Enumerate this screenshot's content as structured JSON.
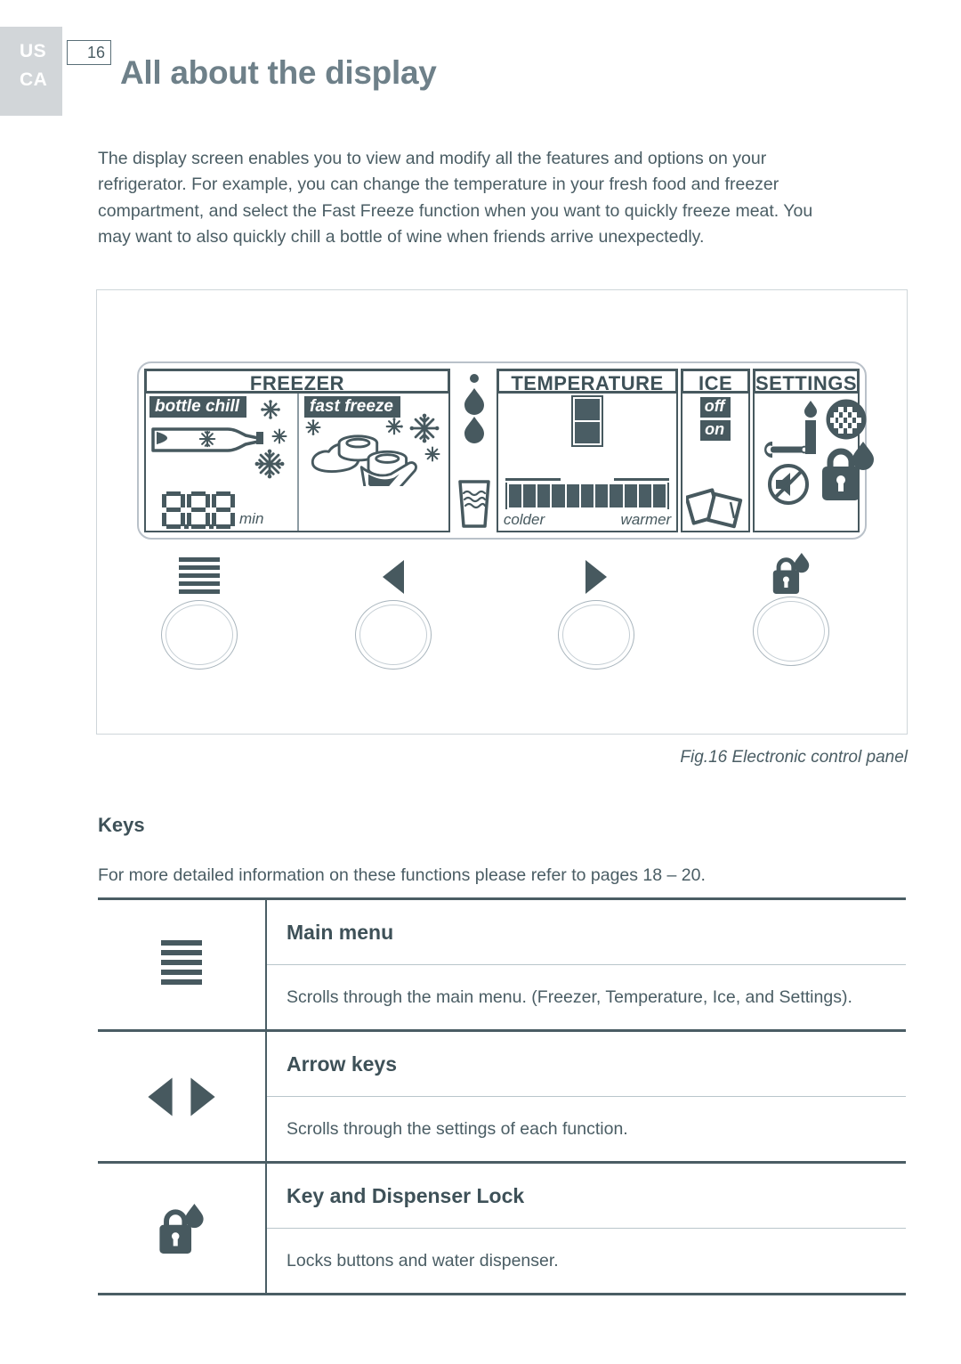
{
  "header": {
    "region_line1": "US",
    "region_line2": "CA",
    "page_number": "16",
    "title": "All about the display"
  },
  "intro": {
    "paragraph": "The display screen enables you to view and modify all the features and options on your refrigerator. For example, you can change the temperature in your fresh food and freezer compartment, and select the Fast Freeze function when you want to quickly freeze meat. You may want to also quickly chill a bottle of wine when friends arrive unexpectedly."
  },
  "figure": {
    "caption": "Fig.16 Electronic control panel",
    "lcd": {
      "freezer": {
        "title": "FREEZER",
        "bottle_chill_label": "bottle chill",
        "fast_freeze_label": "fast freeze",
        "timer_digits": "8.8.8",
        "timer_unit": "min"
      },
      "temperature": {
        "title": "TEMPERATURE",
        "colder_label": "colder",
        "warmer_label": "warmer",
        "segments": 11
      },
      "ice": {
        "title": "ICE",
        "off_label": "off",
        "on_label": "on"
      },
      "settings": {
        "title": "SETTINGS"
      }
    },
    "buttons": [
      {
        "name": "main-menu",
        "icon": "hamburger-icon"
      },
      {
        "name": "left-arrow",
        "icon": "arrow-left-icon"
      },
      {
        "name": "right-arrow",
        "icon": "arrow-right-icon"
      },
      {
        "name": "key-lock",
        "icon": "lock-drop-icon"
      }
    ]
  },
  "keys_section": {
    "heading": "Keys",
    "note": "For more detailed information on these functions please refer to pages 18 – 20.",
    "rows": [
      {
        "icon": "hamburger-icon",
        "title": "Main menu",
        "description": "Scrolls through the main menu. (Freezer, Temperature, Ice, and Settings)."
      },
      {
        "icon": "arrow-keys-icon",
        "title": "Arrow keys",
        "description": "Scrolls through the settings of each function."
      },
      {
        "icon": "lock-drop-icon",
        "title": "Key and Dispenser Lock",
        "description": "Locks buttons and water dispenser."
      }
    ]
  },
  "colors": {
    "ink": "#4a5d64",
    "lcd_dark": "#47595f",
    "title_gray": "#6e8089",
    "tab_gray": "#d2d6d9",
    "rule": "#4a5d64"
  }
}
